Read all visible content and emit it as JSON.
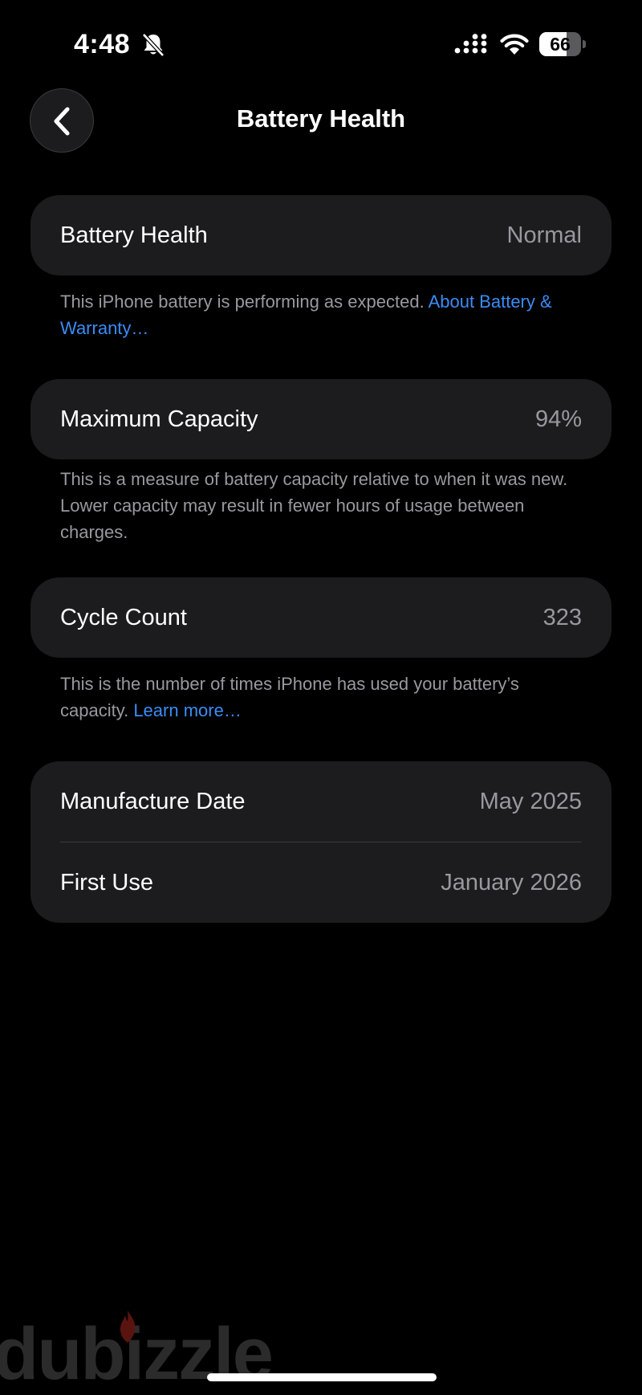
{
  "status_bar": {
    "time": "4:48",
    "battery_level": "66",
    "battery_fraction": 0.66
  },
  "nav": {
    "title": "Battery Health",
    "back_icon": "chevron-left-icon"
  },
  "battery_health": {
    "label": "Battery Health",
    "value": "Normal",
    "footnote_text": "This iPhone battery is performing as expected. ",
    "footnote_link": "About Battery & Warranty…"
  },
  "maximum_capacity": {
    "label": "Maximum Capacity",
    "value": "94%",
    "footnote_text": "This is a measure of battery capacity relative to when it was new. Lower capacity may result in fewer hours of usage between charges."
  },
  "cycle_count": {
    "label": "Cycle Count",
    "value": "323",
    "footnote_text": "This is the number of times iPhone has used your battery’s capacity. ",
    "footnote_link": "Learn more…"
  },
  "dates": {
    "manufacture_label": "Manufacture Date",
    "manufacture_value": "May 2025",
    "first_use_label": "First Use",
    "first_use_value": "January 2026"
  },
  "watermark": {
    "text": "dubizzle"
  },
  "colors": {
    "background": "#000000",
    "card": "#1c1c1e",
    "secondary_text": "#98989f",
    "link": "#3b8cf5"
  }
}
